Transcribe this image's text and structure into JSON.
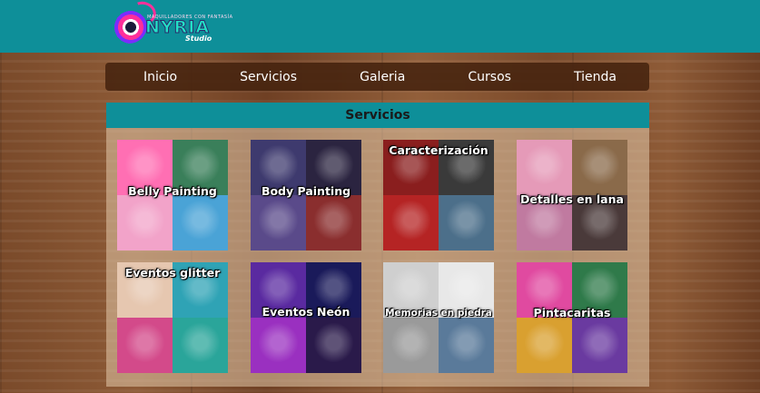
{
  "header": {
    "logo": {
      "tagline": "MAQUILLADORES CON FANTASÍA",
      "brand": "NYRIA",
      "sub": "Studio"
    }
  },
  "nav": {
    "items": [
      {
        "label": "Inicio"
      },
      {
        "label": "Servicios"
      },
      {
        "label": "Galeria"
      },
      {
        "label": "Cursos"
      },
      {
        "label": "Tienda"
      }
    ]
  },
  "section": {
    "title": "Servicios"
  },
  "services": [
    {
      "label": "Belly Painting",
      "colors": [
        "#ff6fb3",
        "#3a7f5a",
        "#f2a3c9",
        "#4aa3d6"
      ]
    },
    {
      "label": "Body Painting",
      "colors": [
        "#3e3a6e",
        "#2b2440",
        "#5a4a8a",
        "#8a2e2e"
      ]
    },
    {
      "label": "Caracterización",
      "colors": [
        "#8a1e1e",
        "#3a3a3a",
        "#b52424",
        "#4c6f8a"
      ]
    },
    {
      "label": "Detalles en lana",
      "colors": [
        "#e59ab8",
        "#8a6a4a",
        "#c07aa0",
        "#4a3a3a"
      ]
    },
    {
      "label": "Eventos glitter",
      "colors": [
        "#e6c7b0",
        "#2fa3b5",
        "#d34a8a",
        "#2aa59a"
      ]
    },
    {
      "label": "Eventos Neón",
      "colors": [
        "#5a2aa0",
        "#1a1a5a",
        "#9a30c0",
        "#2a1a4a"
      ]
    },
    {
      "label": "Memorias en piedra",
      "colors": [
        "#cfcfcf",
        "#e8e8e8",
        "#9a9a9a",
        "#5a7a9a"
      ]
    },
    {
      "label": "Pintacaritas",
      "colors": [
        "#e04aa0",
        "#2f7a4a",
        "#d9a030",
        "#6a3aa0"
      ]
    }
  ]
}
